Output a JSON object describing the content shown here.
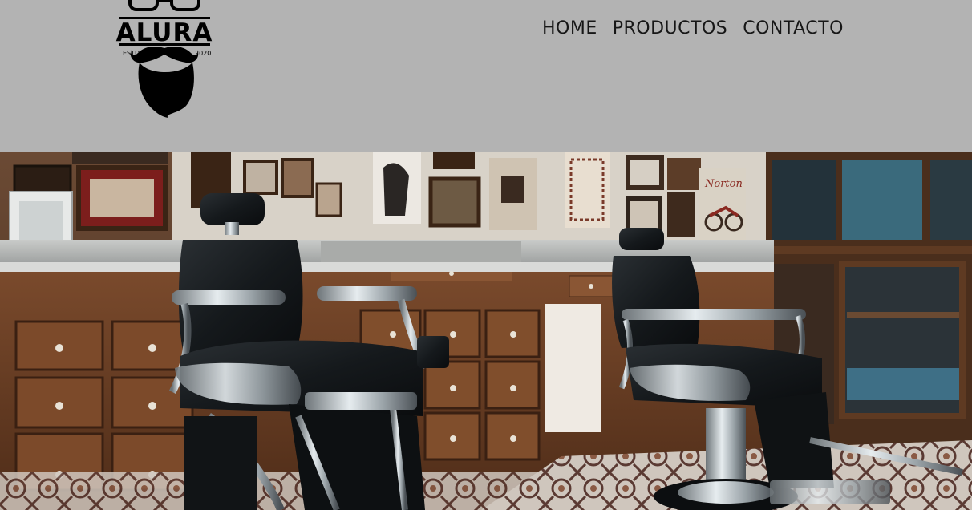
{
  "header": {
    "logo": {
      "brand": "ALURA",
      "left_text": "ESTD",
      "right_text": "2020",
      "icon": "bearded-man-logo-icon"
    },
    "nav": {
      "items": [
        {
          "label": "HOME"
        },
        {
          "label": "PRODUCTOS"
        },
        {
          "label": "CONTACTO"
        }
      ]
    }
  },
  "hero": {
    "image": "barbershop-interior-photo",
    "poster_text": "Norton"
  },
  "colors": {
    "header_bg": "#b3b3b3",
    "nav_text": "#161616",
    "logo": "#000000"
  }
}
